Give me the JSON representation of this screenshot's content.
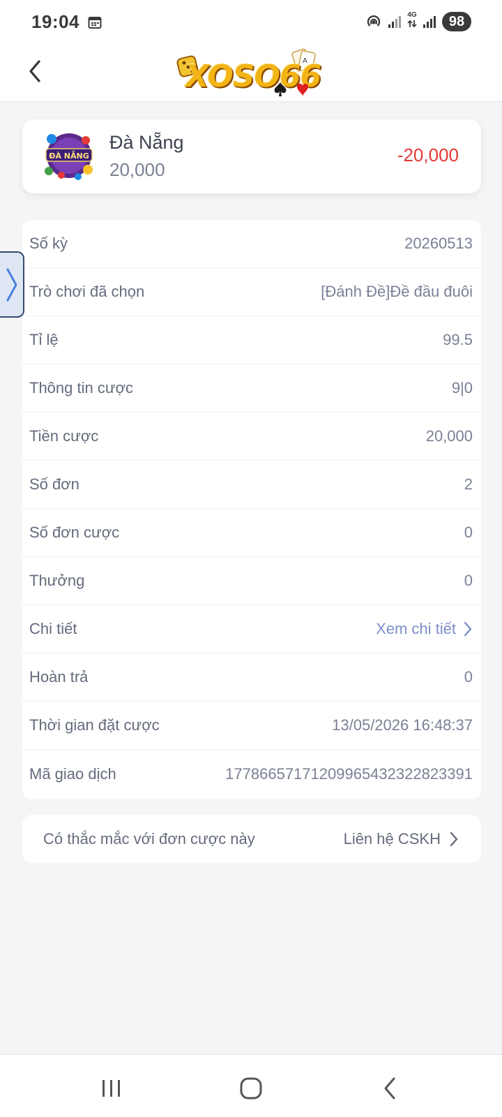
{
  "status_bar": {
    "time": "19:04",
    "network": "4G",
    "battery": "98"
  },
  "header": {
    "logo_text": "XOSO66"
  },
  "summary": {
    "game_name": "Đà Nẵng",
    "thumb_label": "ĐÀ NẴNG",
    "bet_amount": "20,000",
    "win_loss": "-20,000",
    "loss_color": "#e53935"
  },
  "details": {
    "rows": [
      {
        "label": "Số kỳ",
        "value": "20260513"
      },
      {
        "label": "Trò chơi đã chọn",
        "value": "[Đánh Đề]Đề đầu đuôi"
      },
      {
        "label": "Tỉ lệ",
        "value": "99.5"
      },
      {
        "label": "Thông tin cược",
        "value": "9|0"
      },
      {
        "label": "Tiền cược",
        "value": "20,000"
      },
      {
        "label": "Số đơn",
        "value": "2"
      },
      {
        "label": "Số đơn cược",
        "value": "0"
      },
      {
        "label": "Thưởng",
        "value": "0"
      },
      {
        "label": "Chi tiết",
        "value": "Xem chi tiết",
        "link": true
      },
      {
        "label": "Hoàn trả",
        "value": "0"
      },
      {
        "label": "Thời gian đặt cược",
        "value": "13/05/2026 16:48:37"
      },
      {
        "label": "Mã giao dịch",
        "value": "1778665717120996543232282339​1"
      }
    ]
  },
  "support": {
    "question": "Có thắc mắc với đơn cược này",
    "link_label": "Liên hệ CSKH"
  },
  "icons": {
    "back": "chevron-left-icon",
    "side_tab": "chevron-right-icon",
    "nav_recent": "recent-apps-icon",
    "nav_home": "home-icon",
    "nav_back": "back-icon"
  },
  "colors": {
    "accent_link": "#7b8fc9",
    "logo_gold": "#f3b416"
  }
}
